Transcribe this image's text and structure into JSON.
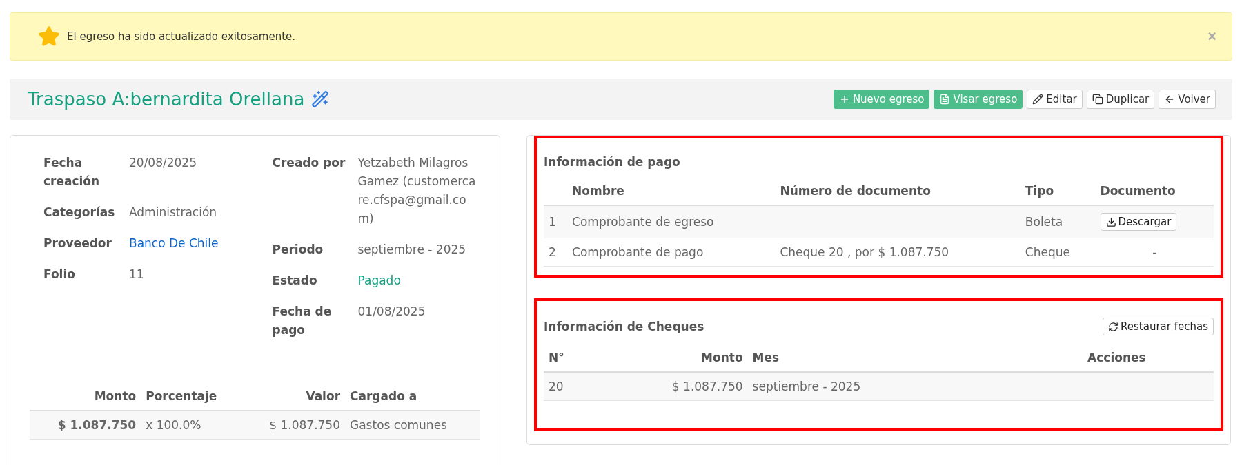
{
  "alert": {
    "message": "El egreso ha sido actualizado exitosamente.",
    "close": "×"
  },
  "header": {
    "title": "Traspaso A:bernardita Orellana",
    "buttons": [
      {
        "label": "Nuevo egreso",
        "kind": "primary"
      },
      {
        "label": "Visar egreso",
        "kind": "primary"
      },
      {
        "label": "Editar",
        "kind": "outline"
      },
      {
        "label": "Duplicar",
        "kind": "outline"
      },
      {
        "label": "Volver",
        "kind": "outline"
      }
    ]
  },
  "details": {
    "left": [
      {
        "label": "Fecha creación",
        "value": "20/08/2025",
        "kind": "text"
      },
      {
        "label": "Categorías",
        "value": "Administración",
        "kind": "text"
      },
      {
        "label": "Proveedor",
        "value": "Banco De Chile",
        "kind": "link"
      },
      {
        "label": "Folio",
        "value": "11",
        "kind": "text"
      }
    ],
    "right": [
      {
        "label": "Creado por",
        "value": "Yetzabeth Milagros Gamez (customercare.cfspa@gmail.com)",
        "kind": "text"
      },
      {
        "label": "Periodo",
        "value": "septiembre - 2025",
        "kind": "text"
      },
      {
        "label": "Estado",
        "value": "Pagado",
        "kind": "status"
      },
      {
        "label": "Fecha de pago",
        "value": "01/08/2025",
        "kind": "text"
      }
    ]
  },
  "charges": {
    "columns": [
      "Monto",
      "Porcentaje",
      "Valor",
      "Cargado a"
    ],
    "rows": [
      [
        "$ 1.087.750",
        "x 100.0%",
        "$ 1.087.750",
        "Gastos comunes"
      ]
    ]
  },
  "payment_info": {
    "title": "Información de pago",
    "highlighted": true,
    "columns": [
      "Nombre",
      "Número de documento",
      "Tipo",
      "Documento"
    ],
    "rows": [
      {
        "index": "1",
        "name": "Comprobante de egreso",
        "number": "",
        "type": "Boleta",
        "document": {
          "kind": "button",
          "label": "Descargar"
        }
      },
      {
        "index": "2",
        "name": "Comprobante de pago",
        "number": "Cheque 20 , por $ 1.087.750",
        "type": "Cheque",
        "document": {
          "kind": "text",
          "label": "-"
        }
      }
    ]
  },
  "cheques": {
    "title": "Información de Cheques",
    "highlighted": true,
    "button": "Restaurar fechas",
    "columns": [
      "N°",
      "Monto",
      "Mes",
      "Acciones"
    ],
    "rows": [
      [
        "20",
        "$ 1.087.750",
        "septiembre - 2025"
      ]
    ]
  }
}
